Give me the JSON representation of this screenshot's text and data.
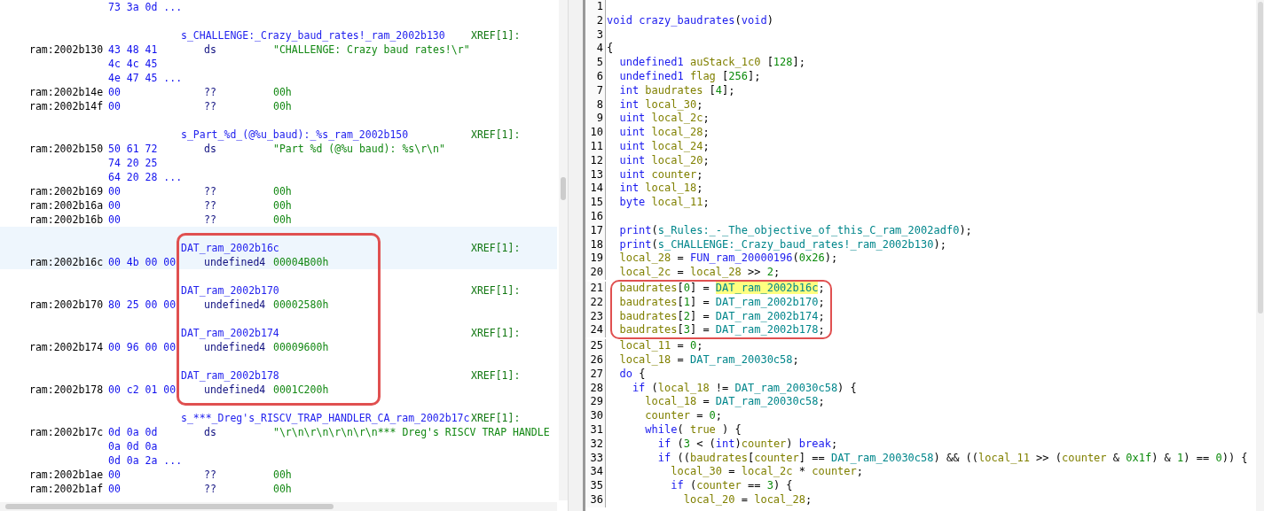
{
  "listing": {
    "rows": [
      {
        "kind": "bytes",
        "bytes": "73 3a 0d ...",
        "highlighted": false
      },
      {
        "kind": "blank",
        "highlighted": false
      },
      {
        "kind": "label",
        "label": "s_CHALLENGE:_Crazy_baud_rates!_ram_2002b130",
        "xref": "XREF[1]:",
        "highlighted": false
      },
      {
        "kind": "data",
        "address": "ram:2002b130",
        "bytes": "43 48 41",
        "mnemonic": "ds",
        "operand": "\"CHALLENGE: Crazy baud rates!\\r\"",
        "highlighted": false
      },
      {
        "kind": "bytes",
        "bytes": "4c 4c 45",
        "highlighted": false
      },
      {
        "kind": "bytes",
        "bytes": "4e 47 45 ...",
        "highlighted": false
      },
      {
        "kind": "data",
        "address": "ram:2002b14e",
        "bytes": "00",
        "mnemonic": "??",
        "operand": "00h",
        "highlighted": false
      },
      {
        "kind": "data",
        "address": "ram:2002b14f",
        "bytes": "00",
        "mnemonic": "??",
        "operand": "00h",
        "highlighted": false
      },
      {
        "kind": "blank",
        "highlighted": false
      },
      {
        "kind": "label",
        "label": "s_Part_%d_(@%u_baud):_%s_ram_2002b150",
        "xref": "XREF[1]:",
        "highlighted": false
      },
      {
        "kind": "data",
        "address": "ram:2002b150",
        "bytes": "50 61 72",
        "mnemonic": "ds",
        "operand": "\"Part %d (@%u baud): %s\\r\\n\"",
        "highlighted": false
      },
      {
        "kind": "bytes",
        "bytes": "74 20 25",
        "highlighted": false
      },
      {
        "kind": "bytes",
        "bytes": "64 20 28 ...",
        "highlighted": false
      },
      {
        "kind": "data",
        "address": "ram:2002b169",
        "bytes": "00",
        "mnemonic": "??",
        "operand": "00h",
        "highlighted": false
      },
      {
        "kind": "data",
        "address": "ram:2002b16a",
        "bytes": "00",
        "mnemonic": "??",
        "operand": "00h",
        "highlighted": false
      },
      {
        "kind": "data",
        "address": "ram:2002b16b",
        "bytes": "00",
        "mnemonic": "??",
        "operand": "00h",
        "highlighted": false
      },
      {
        "kind": "callout",
        "rows": [
          {
            "kind": "blank",
            "highlighted": true
          },
          {
            "kind": "label",
            "label": "DAT_ram_2002b16c",
            "xref": "XREF[1]:",
            "highlighted": true
          },
          {
            "kind": "data",
            "address": "ram:2002b16c",
            "bytes": "00 4b 00 00",
            "mnemonic": "undefined4",
            "operand": "00004B00h",
            "highlighted": true
          },
          {
            "kind": "blank",
            "highlighted": false
          },
          {
            "kind": "label",
            "label": "DAT_ram_2002b170",
            "xref": "XREF[1]:",
            "highlighted": false
          },
          {
            "kind": "data",
            "address": "ram:2002b170",
            "bytes": "80 25 00 00",
            "mnemonic": "undefined4",
            "operand": "00002580h",
            "highlighted": false
          },
          {
            "kind": "blank",
            "highlighted": false
          },
          {
            "kind": "label",
            "label": "DAT_ram_2002b174",
            "xref": "XREF[1]:",
            "highlighted": false
          },
          {
            "kind": "data",
            "address": "ram:2002b174",
            "bytes": "00 96 00 00",
            "mnemonic": "undefined4",
            "operand": "00009600h",
            "highlighted": false
          },
          {
            "kind": "blank",
            "highlighted": false
          },
          {
            "kind": "label",
            "label": "DAT_ram_2002b178",
            "xref": "XREF[1]:",
            "highlighted": false
          },
          {
            "kind": "data",
            "address": "ram:2002b178",
            "bytes": "00 c2 01 00",
            "mnemonic": "undefined4",
            "operand": "0001C200h",
            "highlighted": false
          }
        ]
      },
      {
        "kind": "blank",
        "highlighted": false
      },
      {
        "kind": "label",
        "label": "s_***_Dreg's_RISCV_TRAP_HANDLER_CA_ram_2002b17c",
        "xref": "XREF[1]:",
        "highlighted": false
      },
      {
        "kind": "data",
        "address": "ram:2002b17c",
        "bytes": "0d 0a 0d",
        "mnemonic": "ds",
        "operand": "\"\\r\\n\\r\\n\\r\\n\\r\\n*** Dreg's RISCV TRAP HANDLE",
        "highlighted": false
      },
      {
        "kind": "bytes",
        "bytes": "0a 0d 0a",
        "highlighted": false
      },
      {
        "kind": "bytes",
        "bytes": "0d 0a 2a ...",
        "highlighted": false
      },
      {
        "kind": "data",
        "address": "ram:2002b1ae",
        "bytes": "00",
        "mnemonic": "??",
        "operand": "00h",
        "highlighted": false
      },
      {
        "kind": "data",
        "address": "ram:2002b1af",
        "bytes": "00",
        "mnemonic": "??",
        "operand": "00h",
        "highlighted": false
      }
    ]
  },
  "decompiler": {
    "lines": [
      {
        "kind": "code",
        "number": "1"
      },
      {
        "kind": "code",
        "number": "2",
        "tokens": [
          {
            "kind": "kw",
            "text": "void"
          },
          {
            "kind": "fn",
            "text": " crazy_baudrates"
          },
          {
            "kind": "p",
            "text": "("
          },
          {
            "kind": "kw",
            "text": "void"
          },
          {
            "kind": "p",
            "text": ")"
          }
        ]
      },
      {
        "kind": "code",
        "number": "3"
      },
      {
        "kind": "code",
        "number": "4",
        "tokens": [
          {
            "kind": "p",
            "text": "{"
          }
        ]
      },
      {
        "kind": "code",
        "number": "5",
        "tokens": [
          {
            "kind": "kw",
            "text": "  undefined1"
          },
          {
            "kind": "var",
            "text": " auStack_1c0"
          },
          {
            "kind": "p",
            "text": " ["
          },
          {
            "kind": "num",
            "text": "128"
          },
          {
            "kind": "p",
            "text": "];"
          }
        ]
      },
      {
        "kind": "code",
        "number": "6",
        "tokens": [
          {
            "kind": "kw",
            "text": "  undefined1"
          },
          {
            "kind": "var",
            "text": " flag"
          },
          {
            "kind": "p",
            "text": " ["
          },
          {
            "kind": "num",
            "text": "256"
          },
          {
            "kind": "p",
            "text": "];"
          }
        ]
      },
      {
        "kind": "code",
        "number": "7",
        "tokens": [
          {
            "kind": "kw",
            "text": "  int"
          },
          {
            "kind": "var",
            "text": " baudrates"
          },
          {
            "kind": "p",
            "text": " ["
          },
          {
            "kind": "num",
            "text": "4"
          },
          {
            "kind": "p",
            "text": "];"
          }
        ]
      },
      {
        "kind": "code",
        "number": "8",
        "tokens": [
          {
            "kind": "kw",
            "text": "  int"
          },
          {
            "kind": "var",
            "text": " local_30"
          },
          {
            "kind": "p",
            "text": ";"
          }
        ]
      },
      {
        "kind": "code",
        "number": "9",
        "tokens": [
          {
            "kind": "kw",
            "text": "  uint"
          },
          {
            "kind": "var",
            "text": " local_2c"
          },
          {
            "kind": "p",
            "text": ";"
          }
        ]
      },
      {
        "kind": "code",
        "number": "10",
        "tokens": [
          {
            "kind": "kw",
            "text": "  uint"
          },
          {
            "kind": "var",
            "text": " local_28"
          },
          {
            "kind": "p",
            "text": ";"
          }
        ]
      },
      {
        "kind": "code",
        "number": "11",
        "tokens": [
          {
            "kind": "kw",
            "text": "  uint"
          },
          {
            "kind": "var",
            "text": " local_24"
          },
          {
            "kind": "p",
            "text": ";"
          }
        ]
      },
      {
        "kind": "code",
        "number": "12",
        "tokens": [
          {
            "kind": "kw",
            "text": "  uint"
          },
          {
            "kind": "var",
            "text": " local_20"
          },
          {
            "kind": "p",
            "text": ";"
          }
        ]
      },
      {
        "kind": "code",
        "number": "13",
        "tokens": [
          {
            "kind": "kw",
            "text": "  uint"
          },
          {
            "kind": "var",
            "text": " counter"
          },
          {
            "kind": "p",
            "text": ";"
          }
        ]
      },
      {
        "kind": "code",
        "number": "14",
        "tokens": [
          {
            "kind": "kw",
            "text": "  int"
          },
          {
            "kind": "var",
            "text": " local_18"
          },
          {
            "kind": "p",
            "text": ";"
          }
        ]
      },
      {
        "kind": "code",
        "number": "15",
        "tokens": [
          {
            "kind": "kw",
            "text": "  byte"
          },
          {
            "kind": "var",
            "text": " local_11"
          },
          {
            "kind": "p",
            "text": ";"
          }
        ]
      },
      {
        "kind": "code",
        "number": "16"
      },
      {
        "kind": "code",
        "number": "17",
        "tokens": [
          {
            "kind": "fn",
            "text": "  print"
          },
          {
            "kind": "p",
            "text": "("
          },
          {
            "kind": "glob",
            "text": "s_Rules:_-_The_objective_of_this_C_ram_2002adf0"
          },
          {
            "kind": "p",
            "text": ");"
          }
        ]
      },
      {
        "kind": "code",
        "number": "18",
        "tokens": [
          {
            "kind": "fn",
            "text": "  print"
          },
          {
            "kind": "p",
            "text": "("
          },
          {
            "kind": "glob",
            "text": "s_CHALLENGE:_Crazy_baud_rates!_ram_2002b130"
          },
          {
            "kind": "p",
            "text": ");"
          }
        ]
      },
      {
        "kind": "code",
        "number": "19",
        "tokens": [
          {
            "kind": "var",
            "text": "  local_28"
          },
          {
            "kind": "p",
            "text": " = "
          },
          {
            "kind": "fn",
            "text": "FUN_ram_20000196"
          },
          {
            "kind": "p",
            "text": "("
          },
          {
            "kind": "num",
            "text": "0x26"
          },
          {
            "kind": "p",
            "text": ");"
          }
        ]
      },
      {
        "kind": "code",
        "number": "20",
        "tokens": [
          {
            "kind": "var",
            "text": "  local_2c"
          },
          {
            "kind": "p",
            "text": " = "
          },
          {
            "kind": "var",
            "text": "local_28"
          },
          {
            "kind": "p",
            "text": " >> "
          },
          {
            "kind": "num",
            "text": "2"
          },
          {
            "kind": "p",
            "text": ";"
          }
        ]
      },
      {
        "kind": "callout",
        "lines": [
          {
            "kind": "code",
            "number": "21",
            "tokens": [
              {
                "kind": "var",
                "text": "  baudrates"
              },
              {
                "kind": "p",
                "text": "["
              },
              {
                "kind": "num",
                "text": "0"
              },
              {
                "kind": "p",
                "text": "] = "
              },
              {
                "kind": "selection",
                "text": "DAT_ram_2002b16c"
              },
              {
                "kind": "p",
                "text": ";"
              }
            ]
          },
          {
            "kind": "code",
            "number": "22",
            "tokens": [
              {
                "kind": "var",
                "text": "  baudrates"
              },
              {
                "kind": "p",
                "text": "["
              },
              {
                "kind": "num",
                "text": "1"
              },
              {
                "kind": "p",
                "text": "] = "
              },
              {
                "kind": "glob",
                "text": "DAT_ram_2002b170"
              },
              {
                "kind": "p",
                "text": ";"
              }
            ]
          },
          {
            "kind": "code",
            "number": "23",
            "tokens": [
              {
                "kind": "var",
                "text": "  baudrates"
              },
              {
                "kind": "p",
                "text": "["
              },
              {
                "kind": "num",
                "text": "2"
              },
              {
                "kind": "p",
                "text": "] = "
              },
              {
                "kind": "glob",
                "text": "DAT_ram_2002b174"
              },
              {
                "kind": "p",
                "text": ";"
              }
            ]
          },
          {
            "kind": "code",
            "number": "24",
            "tokens": [
              {
                "kind": "var",
                "text": "  baudrates"
              },
              {
                "kind": "p",
                "text": "["
              },
              {
                "kind": "num",
                "text": "3"
              },
              {
                "kind": "p",
                "text": "] = "
              },
              {
                "kind": "glob",
                "text": "DAT_ram_2002b178"
              },
              {
                "kind": "p",
                "text": ";"
              }
            ]
          }
        ]
      },
      {
        "kind": "code",
        "number": "25",
        "tokens": [
          {
            "kind": "var",
            "text": "  local_11"
          },
          {
            "kind": "p",
            "text": " = "
          },
          {
            "kind": "num",
            "text": "0"
          },
          {
            "kind": "p",
            "text": ";"
          }
        ]
      },
      {
        "kind": "code",
        "number": "26",
        "tokens": [
          {
            "kind": "var",
            "text": "  local_18"
          },
          {
            "kind": "p",
            "text": " = "
          },
          {
            "kind": "glob",
            "text": "DAT_ram_20030c58"
          },
          {
            "kind": "p",
            "text": ";"
          }
        ]
      },
      {
        "kind": "code",
        "number": "27",
        "tokens": [
          {
            "kind": "kw",
            "text": "  do"
          },
          {
            "kind": "p",
            "text": " {"
          }
        ]
      },
      {
        "kind": "code",
        "number": "28",
        "tokens": [
          {
            "kind": "kw",
            "text": "    if"
          },
          {
            "kind": "p",
            "text": " ("
          },
          {
            "kind": "var",
            "text": "local_18"
          },
          {
            "kind": "p",
            "text": " != "
          },
          {
            "kind": "glob",
            "text": "DAT_ram_20030c58"
          },
          {
            "kind": "p",
            "text": ") {"
          }
        ]
      },
      {
        "kind": "code",
        "number": "29",
        "tokens": [
          {
            "kind": "var",
            "text": "      local_18"
          },
          {
            "kind": "p",
            "text": " = "
          },
          {
            "kind": "glob",
            "text": "DAT_ram_20030c58"
          },
          {
            "kind": "p",
            "text": ";"
          }
        ]
      },
      {
        "kind": "code",
        "number": "30",
        "tokens": [
          {
            "kind": "var",
            "text": "      counter"
          },
          {
            "kind": "p",
            "text": " = "
          },
          {
            "kind": "num",
            "text": "0"
          },
          {
            "kind": "p",
            "text": ";"
          }
        ]
      },
      {
        "kind": "code",
        "number": "31",
        "tokens": [
          {
            "kind": "kw",
            "text": "      while"
          },
          {
            "kind": "p",
            "text": "( "
          },
          {
            "kind": "var",
            "text": "true"
          },
          {
            "kind": "p",
            "text": " ) {"
          }
        ]
      },
      {
        "kind": "code",
        "number": "32",
        "tokens": [
          {
            "kind": "kw",
            "text": "        if"
          },
          {
            "kind": "p",
            "text": " ("
          },
          {
            "kind": "num",
            "text": "3"
          },
          {
            "kind": "p",
            "text": " < ("
          },
          {
            "kind": "kw",
            "text": "int"
          },
          {
            "kind": "p",
            "text": ")"
          },
          {
            "kind": "var",
            "text": "counter"
          },
          {
            "kind": "p",
            "text": ") "
          },
          {
            "kind": "kw",
            "text": "break"
          },
          {
            "kind": "p",
            "text": ";"
          }
        ]
      },
      {
        "kind": "code",
        "number": "33",
        "tokens": [
          {
            "kind": "kw",
            "text": "        if"
          },
          {
            "kind": "p",
            "text": " (("
          },
          {
            "kind": "var",
            "text": "baudrates"
          },
          {
            "kind": "p",
            "text": "["
          },
          {
            "kind": "var",
            "text": "counter"
          },
          {
            "kind": "p",
            "text": "] == "
          },
          {
            "kind": "glob",
            "text": "DAT_ram_20030c58"
          },
          {
            "kind": "p",
            "text": ") && (("
          },
          {
            "kind": "var",
            "text": "local_11"
          },
          {
            "kind": "p",
            "text": " >> ("
          },
          {
            "kind": "var",
            "text": "counter"
          },
          {
            "kind": "p",
            "text": " & "
          },
          {
            "kind": "num",
            "text": "0x1f"
          },
          {
            "kind": "p",
            "text": ") & "
          },
          {
            "kind": "num",
            "text": "1"
          },
          {
            "kind": "p",
            "text": ") == "
          },
          {
            "kind": "num",
            "text": "0"
          },
          {
            "kind": "p",
            "text": ")) {"
          }
        ]
      },
      {
        "kind": "code",
        "number": "34",
        "tokens": [
          {
            "kind": "var",
            "text": "          local_30"
          },
          {
            "kind": "p",
            "text": " = "
          },
          {
            "kind": "var",
            "text": "local_2c"
          },
          {
            "kind": "p",
            "text": " * "
          },
          {
            "kind": "var",
            "text": "counter"
          },
          {
            "kind": "p",
            "text": ";"
          }
        ]
      },
      {
        "kind": "code",
        "number": "35",
        "tokens": [
          {
            "kind": "kw",
            "text": "          if"
          },
          {
            "kind": "p",
            "text": " ("
          },
          {
            "kind": "var",
            "text": "counter"
          },
          {
            "kind": "p",
            "text": " == "
          },
          {
            "kind": "num",
            "text": "3"
          },
          {
            "kind": "p",
            "text": ") {"
          }
        ]
      },
      {
        "kind": "code",
        "number": "36",
        "tokens": [
          {
            "kind": "var",
            "text": "            local_20"
          },
          {
            "kind": "p",
            "text": " = "
          },
          {
            "kind": "var",
            "text": "local_28"
          },
          {
            "kind": "p",
            "text": ";"
          }
        ]
      }
    ]
  }
}
